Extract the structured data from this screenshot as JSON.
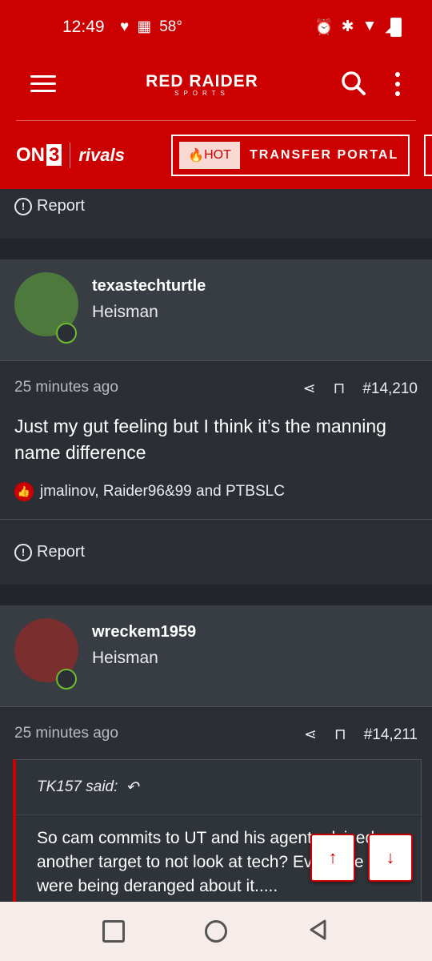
{
  "status_bar": {
    "time": "12:49",
    "temperature": "58°"
  },
  "header": {
    "logo_line1": "RED RAIDER",
    "logo_line2": "SPORTS",
    "on3_text": "ON",
    "on3_number": "3",
    "rivals_text": "rivals",
    "hot_label": "HOT",
    "portal_label": "TRANSFER PORTAL"
  },
  "report_label": "Report",
  "posts": [
    {
      "username": "texastechturtle",
      "rank": "Heisman",
      "time": "25 minutes ago",
      "post_number": "#14,210",
      "message": "Just my gut feeling but I think it’s the manning name difference",
      "likes": "jmalinov, Raider96&99 and PTBSLC"
    },
    {
      "username": "wreckem1959",
      "rank": "Heisman",
      "time": "25 minutes ago",
      "post_number": "#14,211",
      "quote_author": "TK157 said:",
      "quote_text": "So cam commits to UT and his agent advised another target to not look at tech? Everyone were being deranged about it....."
    }
  ],
  "colors": {
    "brand_red": "#cc0000",
    "background": "#2b2f35",
    "online": "#6bbd2f"
  }
}
